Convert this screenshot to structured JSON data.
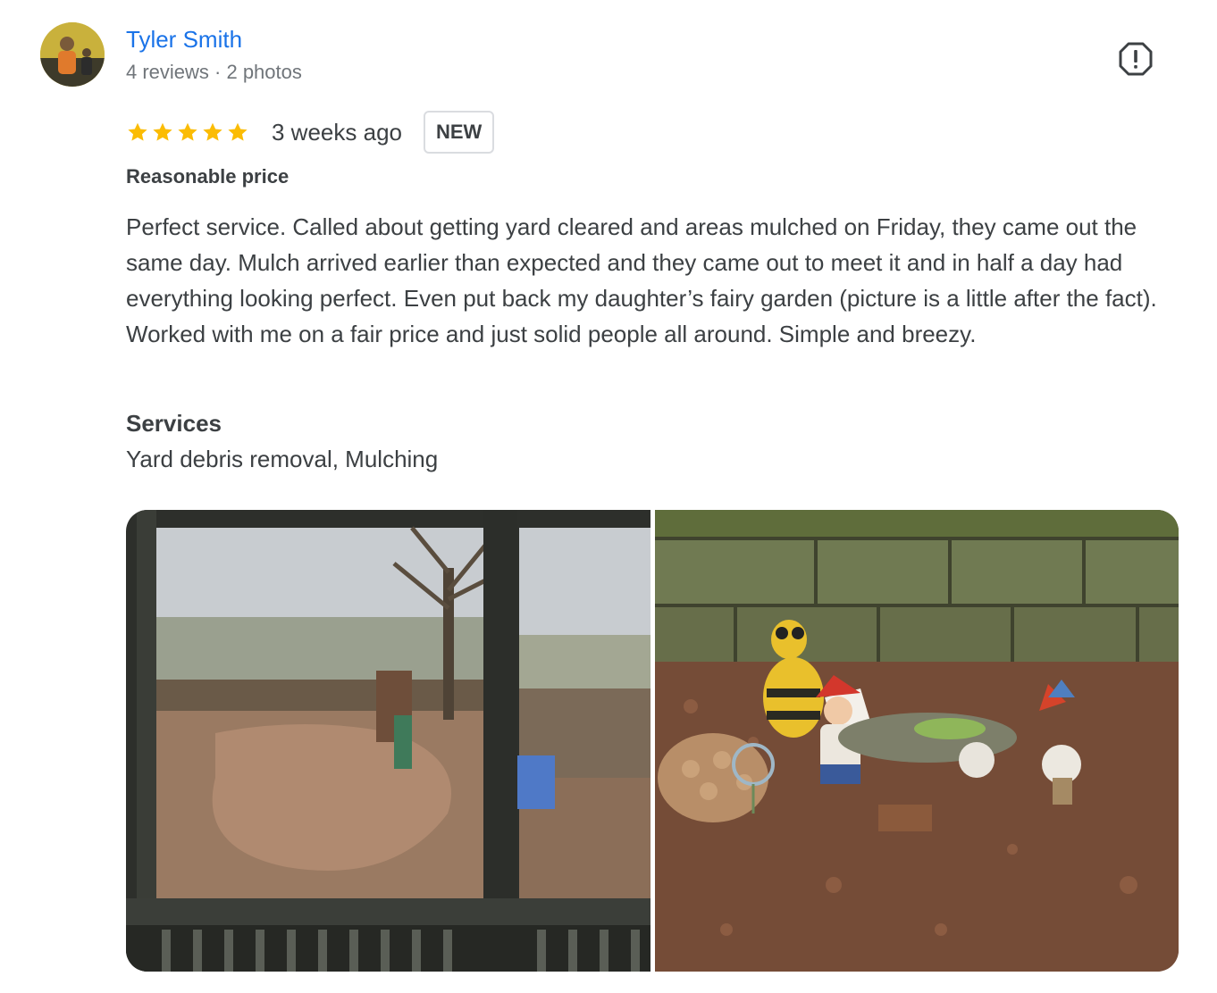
{
  "reviewer": {
    "name": "Tyler Smith",
    "meta": "4 reviews · 2 photos"
  },
  "review": {
    "rating": 5,
    "rating_max": 5,
    "time": "3 weeks ago",
    "badge": "NEW",
    "attribute": "Reasonable price",
    "text": "Perfect service. Called about getting yard cleared and areas mulched on Friday, they came out the same day. Mulch arrived earlier than expected and they came out to meet it and in half a day had everything looking perfect. Even put back my daughter’s fairy garden (picture is a little after the fact). Worked with me on a fair price and just solid people all around. Simple and breezy.",
    "services_title": "Services",
    "services_value": "Yard debris removal, Mulching"
  },
  "icons": {
    "report": "report-icon",
    "star": "star-icon"
  },
  "colors": {
    "name_link": "#1a73e8",
    "star": "#fbbc04",
    "text": "#3c4043",
    "meta": "#70757a"
  }
}
